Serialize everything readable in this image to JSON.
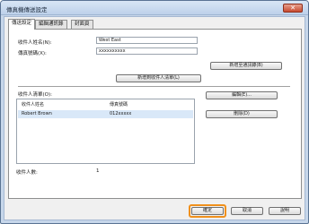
{
  "window": {
    "title": "傳真機傳送設定",
    "close_label": "✕"
  },
  "tabs": [
    {
      "label": "傳送設定"
    },
    {
      "label": "編輯通訊錄"
    },
    {
      "label": "封面頁"
    }
  ],
  "form": {
    "recipient_name_label": "收件人姓名(N):",
    "recipient_name_value": "West East",
    "fax_number_label": "傳真號碼(X):",
    "fax_number_value": "xxxxxxxxxx",
    "add_from_address_book_button": "新增至通訊錄(B)",
    "add_to_recipient_list_button": "新增到收件人清單(L)"
  },
  "recipient_list": {
    "label": "收件人清單(O):",
    "columns": [
      "收件人姓名",
      "傳真號碼"
    ],
    "rows": [
      {
        "name": "Robert Brown",
        "fax": "012xxxxx"
      }
    ],
    "edit_button": "編輯(E)...",
    "delete_button": "刪除(D)"
  },
  "recipient_count": {
    "label": "收件人數:",
    "value": "1"
  },
  "footer": {
    "ok_button": "確定",
    "cancel_button": "取消",
    "help_button": "說明"
  },
  "colors": {
    "highlight": "#f0901c",
    "titlebar": "#bdd1ea",
    "close_button": "#c84a2f"
  }
}
